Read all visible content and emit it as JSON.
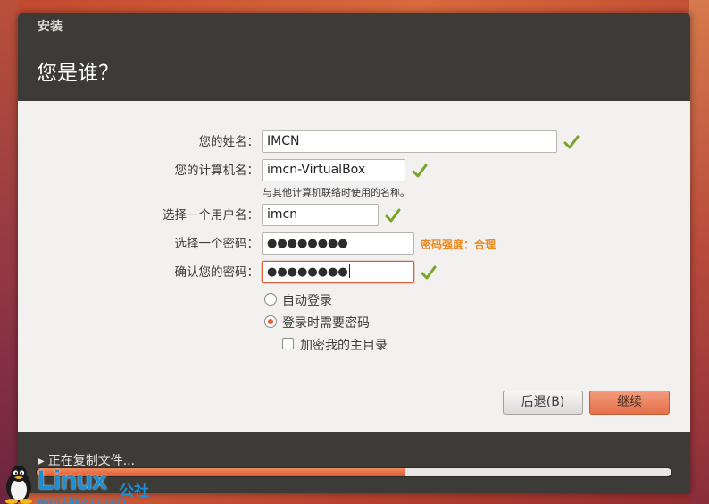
{
  "window": {
    "title": "安装"
  },
  "page": {
    "title": "您是谁？"
  },
  "form": {
    "name_label": "您的姓名：",
    "name_value": "IMCN",
    "computer_label": "您的计算机名：",
    "computer_value": "imcn-VirtualBox",
    "computer_hint": "与其他计算机联络时使用的名称。",
    "username_label": "选择一个用户名：",
    "username_value": "imcn",
    "password_label": "选择一个密码：",
    "password_value": "●●●●●●●●",
    "password_strength": "密码强度：合理",
    "confirm_label": "确认您的密码：",
    "confirm_value": "●●●●●●●●",
    "auto_login_label": "自动登录",
    "require_password_label": "登录时需要密码",
    "encrypt_home_label": "加密我的主目录",
    "login_mode": "require_password",
    "encrypt_home": false
  },
  "buttons": {
    "back_label": "后退(B)",
    "next_label": "继续"
  },
  "footer": {
    "status": "正在复制文件...",
    "progress": 0.58
  },
  "watermark": {
    "brand": "Linux",
    "brand_cn": "公社",
    "url": "www.Linuxidc.com"
  },
  "colors": {
    "accent": "#e0603a",
    "strength": "#ea8a25",
    "header": "#3c3b37",
    "check": "#7aa52a"
  },
  "icons": {
    "valid": "check-icon",
    "expander": "triangle-right-icon",
    "mascot": "tux-penguin-icon"
  }
}
